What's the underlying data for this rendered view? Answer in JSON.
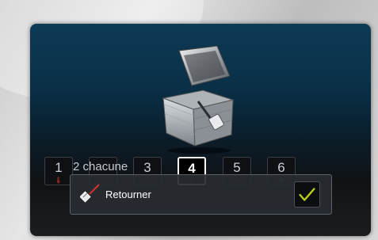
{
  "steps": [
    {
      "number": "1",
      "icon": "thermometer-icon"
    },
    {
      "number": "",
      "icon": "dash-icon"
    },
    {
      "number": "3",
      "icon": "dash-icon"
    },
    {
      "number": "4",
      "icon": "circle-icon",
      "active": true
    },
    {
      "number": "5",
      "icon": "dash-icon"
    },
    {
      "number": "6",
      "icon": "steam-icon"
    }
  ],
  "step_note": "2 chacune",
  "popup": {
    "label": "Retourner",
    "icon": "spatula-icon",
    "confirm_icon": "checkmark-icon",
    "confirm_color": "#b7cc1f"
  },
  "colors": {
    "accent_active": "#ffffff",
    "thermometer": "#d2322d"
  }
}
